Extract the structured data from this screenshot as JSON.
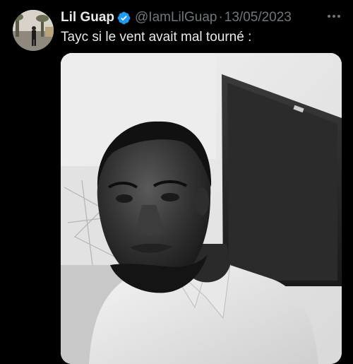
{
  "tweet": {
    "author": {
      "display_name": "Lil Guap",
      "handle": "@IamLilGuap",
      "verified": true,
      "avatar_icon": "profile-photo"
    },
    "separator": "·",
    "date": "13/05/2023",
    "text": "Tayc si le vent avait mal tourné :",
    "media_description": "photo",
    "more_icon": "more-options-icon"
  },
  "colors": {
    "background": "#000000",
    "text_primary": "#e7e9ea",
    "text_secondary": "#71767b",
    "verified_badge": "#1d9bf0"
  }
}
